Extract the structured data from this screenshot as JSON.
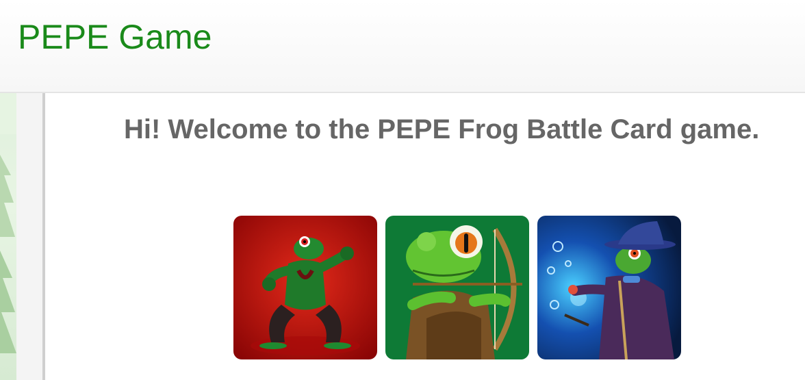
{
  "header": {
    "title": "PEPE Game",
    "title_color": "#1a8a1a"
  },
  "main": {
    "welcome_text": "Hi! Welcome to the PEPE Frog Battle Card game."
  },
  "cards": [
    {
      "name": "fighter",
      "icon": "frog-fighter-card-icon",
      "bg": "#c81010"
    },
    {
      "name": "archer",
      "icon": "frog-archer-card-icon",
      "bg": "#0e7a36"
    },
    {
      "name": "wizard",
      "icon": "frog-wizard-card-icon",
      "bg": "#0f2a66"
    }
  ]
}
